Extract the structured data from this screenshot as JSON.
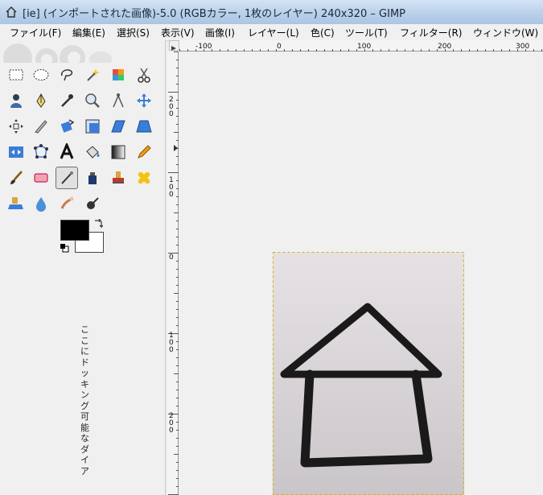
{
  "window": {
    "title": "[ie] (インポートされた画像)-5.0 (RGBカラー, 1枚のレイヤー) 240x320 – GIMP"
  },
  "menu": [
    "ファイル(F)",
    "編集(E)",
    "選択(S)",
    "表示(V)",
    "画像(I)",
    "レイヤー(L)",
    "色(C)",
    "ツール(T)",
    "フィルター(R)",
    "ウィンドウ(W)"
  ],
  "toolbox": {
    "tools": [
      "rect-select",
      "ellipse-select",
      "free-select",
      "fuzzy-select",
      "select-by-color",
      "scissors-select",
      "foreground-select",
      "paths",
      "color-picker",
      "zoom",
      "measure",
      "move",
      "align",
      "crop",
      "rotate",
      "scale",
      "shear",
      "perspective",
      "flip",
      "cage-transform",
      "text",
      "bucket-fill",
      "blend",
      "pencil",
      "paintbrush",
      "eraser",
      "airbrush",
      "ink",
      "clone",
      "heal",
      "perspective-clone",
      "blur",
      "smudge",
      "dodge-burn"
    ],
    "active_tool": "airbrush",
    "foreground_color": "#000000",
    "background_color": "#ffffff"
  },
  "dock_hint": "ここにドッキング可能なダイア",
  "rulers": {
    "horizontal_labels": [
      "-100",
      "0",
      "100",
      "200",
      "300"
    ],
    "vertical_labels": [
      "200",
      "100",
      "0",
      "100",
      "200"
    ]
  }
}
